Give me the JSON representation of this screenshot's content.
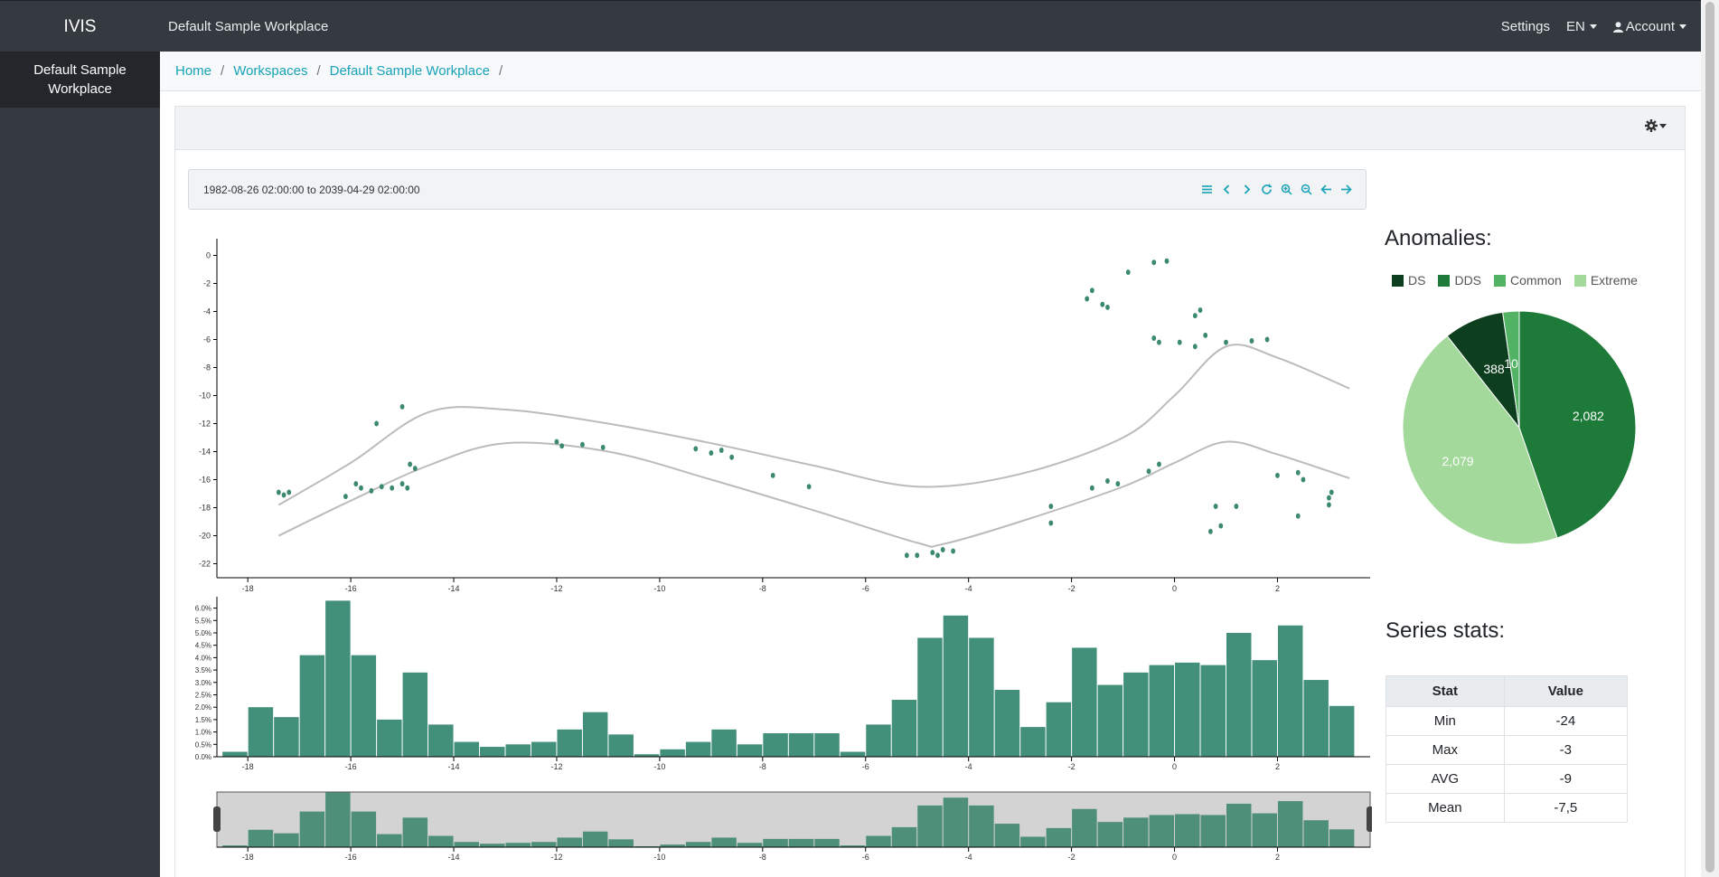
{
  "app": {
    "brand": "IVIS",
    "page_title": "Default Sample Workplace"
  },
  "nav": {
    "settings": "Settings",
    "language": "EN",
    "account": "Account"
  },
  "sidebar": {
    "items": [
      {
        "label": "Default Sample Workplace"
      }
    ]
  },
  "breadcrumb": [
    {
      "label": "Home"
    },
    {
      "label": "Workspaces"
    },
    {
      "label": "Default Sample Workplace"
    }
  ],
  "time_range": {
    "from": "1982-08-26 02:00:00",
    "to_word": "to",
    "to": "2039-04-29 02:00:00"
  },
  "toolbar_icons": [
    "menu-icon",
    "chevron-left-icon",
    "chevron-right-icon",
    "refresh-icon",
    "zoom-in-icon",
    "zoom-out-icon",
    "arrow-left-icon",
    "arrow-right-icon"
  ],
  "anomalies": {
    "title": "Anomalies:",
    "legend": [
      {
        "label": "DS",
        "color": "#0d3f1e"
      },
      {
        "label": "DDS",
        "color": "#1e7a38"
      },
      {
        "label": "Common",
        "color": "#52b365"
      },
      {
        "label": "Extreme",
        "color": "#a3d99b"
      }
    ]
  },
  "series_stats": {
    "title": "Series stats:",
    "headers": [
      "Stat",
      "Value"
    ],
    "rows": [
      {
        "stat": "Min",
        "value": "-24"
      },
      {
        "stat": "Max",
        "value": "-3"
      },
      {
        "stat": "AVG",
        "value": "-9"
      },
      {
        "stat": "Mean",
        "value": "-7,5"
      }
    ]
  },
  "colors": {
    "point": "#3c8a6e",
    "bar": "#43907a",
    "band": "#bbbbbb",
    "link": "#17a2b8"
  },
  "chart_data": [
    {
      "type": "scatter",
      "x_ticks": [
        -18,
        -16,
        -14,
        -12,
        -10,
        -8,
        -6,
        -4,
        -2,
        0,
        2
      ],
      "y_ticks": [
        0,
        -2,
        -4,
        -6,
        -8,
        -10,
        -12,
        -14,
        -16,
        -18,
        -20,
        -22
      ],
      "y_tick_labels": [
        "0",
        "-2",
        "-4",
        "-6",
        "-8",
        "-10",
        "-12",
        "-14",
        "-16",
        "-18",
        "-20",
        "-22"
      ],
      "xlim": [
        -18.6,
        3.8
      ],
      "ylim": [
        -23,
        1
      ],
      "points": [
        [
          -17.4,
          -16.9
        ],
        [
          -17.3,
          -17.1
        ],
        [
          -17.2,
          -16.9
        ],
        [
          -16.1,
          -17.2
        ],
        [
          -15.9,
          -16.3
        ],
        [
          -15.8,
          -16.6
        ],
        [
          -15.6,
          -16.8
        ],
        [
          -15.4,
          -16.5
        ],
        [
          -15.2,
          -16.6
        ],
        [
          -15.0,
          -16.3
        ],
        [
          -14.9,
          -16.6
        ],
        [
          -14.85,
          -14.9
        ],
        [
          -14.75,
          -15.2
        ],
        [
          -15.5,
          -12.0
        ],
        [
          -15.0,
          -10.8
        ],
        [
          -12.0,
          -13.3
        ],
        [
          -11.9,
          -13.6
        ],
        [
          -11.5,
          -13.5
        ],
        [
          -11.1,
          -13.7
        ],
        [
          -9.3,
          -13.8
        ],
        [
          -9.0,
          -14.1
        ],
        [
          -8.8,
          -13.9
        ],
        [
          -8.6,
          -14.4
        ],
        [
          -7.8,
          -15.7
        ],
        [
          -7.1,
          -16.5
        ],
        [
          -5.2,
          -21.4
        ],
        [
          -5.0,
          -21.4
        ],
        [
          -4.7,
          -21.2
        ],
        [
          -4.6,
          -21.4
        ],
        [
          -4.5,
          -21.0
        ],
        [
          -4.3,
          -21.1
        ],
        [
          -2.4,
          -17.9
        ],
        [
          -2.4,
          -19.1
        ],
        [
          -1.6,
          -16.6
        ],
        [
          -1.3,
          -16.1
        ],
        [
          -1.1,
          -16.3
        ],
        [
          -0.5,
          -15.4
        ],
        [
          -0.3,
          -14.9
        ],
        [
          -1.7,
          -3.1
        ],
        [
          -1.6,
          -2.5
        ],
        [
          -1.4,
          -3.5
        ],
        [
          -1.3,
          -3.7
        ],
        [
          -0.9,
          -1.2
        ],
        [
          -0.4,
          -0.5
        ],
        [
          -0.15,
          -0.4
        ],
        [
          -0.4,
          -5.9
        ],
        [
          -0.3,
          -6.2
        ],
        [
          0.1,
          -6.2
        ],
        [
          0.4,
          -4.3
        ],
        [
          0.5,
          -3.9
        ],
        [
          0.4,
          -6.5
        ],
        [
          0.6,
          -5.7
        ],
        [
          1.0,
          -6.2
        ],
        [
          1.5,
          -6.1
        ],
        [
          1.8,
          -6.0
        ],
        [
          0.7,
          -19.7
        ],
        [
          0.9,
          -19.3
        ],
        [
          0.8,
          -17.9
        ],
        [
          1.2,
          -17.9
        ],
        [
          2.0,
          -15.7
        ],
        [
          2.4,
          -15.5
        ],
        [
          2.5,
          -16.0
        ],
        [
          2.4,
          -18.6
        ],
        [
          3.0,
          -17.3
        ],
        [
          3.0,
          -17.8
        ],
        [
          3.05,
          -16.9
        ]
      ],
      "upper_band": [
        [
          -17.4,
          -17.8
        ],
        [
          -16,
          -14.8
        ],
        [
          -14.5,
          -11.2
        ],
        [
          -13,
          -11.0
        ],
        [
          -11,
          -12.0
        ],
        [
          -9,
          -13.4
        ],
        [
          -7,
          -15.0
        ],
        [
          -5,
          -16.5
        ],
        [
          -3,
          -15.6
        ],
        [
          -1,
          -13.0
        ],
        [
          0,
          -10.0
        ],
        [
          1,
          -6.5
        ],
        [
          2,
          -7.3
        ],
        [
          3.4,
          -9.5
        ]
      ],
      "lower_band": [
        [
          -17.4,
          -20.0
        ],
        [
          -16,
          -17.5
        ],
        [
          -14.5,
          -15.0
        ],
        [
          -13,
          -13.4
        ],
        [
          -11,
          -14.0
        ],
        [
          -9,
          -16.0
        ],
        [
          -7,
          -18.2
        ],
        [
          -5,
          -20.5
        ],
        [
          -4.5,
          -20.6
        ],
        [
          -3,
          -19.0
        ],
        [
          -1,
          -16.5
        ],
        [
          0,
          -14.8
        ],
        [
          1,
          -13.3
        ],
        [
          2,
          -14.2
        ],
        [
          3.4,
          -15.9
        ]
      ]
    },
    {
      "type": "bar",
      "x_start": -18.5,
      "bin_width": 0.5,
      "values": [
        0.2,
        2.0,
        1.6,
        4.1,
        6.3,
        4.1,
        1.5,
        3.4,
        1.3,
        0.6,
        0.4,
        0.5,
        0.6,
        1.1,
        1.8,
        0.9,
        0.1,
        0.3,
        0.6,
        1.1,
        0.5,
        0.95,
        0.95,
        0.95,
        0.2,
        1.3,
        2.3,
        4.8,
        5.7,
        4.8,
        2.7,
        1.2,
        2.2,
        4.4,
        2.9,
        3.4,
        3.7,
        3.8,
        3.7,
        5.0,
        3.9,
        5.3,
        3.1,
        2.05
      ],
      "y_ticks": [
        0,
        0.5,
        1,
        1.5,
        2,
        2.5,
        3,
        3.5,
        4,
        4.5,
        5,
        5.5,
        6
      ],
      "y_tick_labels": [
        "0.0%",
        "0.5%",
        "1.0%",
        "1.5%",
        "2.0%",
        "2.5%",
        "3.0%",
        "3.5%",
        "4.0%",
        "4.5%",
        "5.0%",
        "5.5%",
        "6.0%"
      ],
      "ylim": [
        0,
        6.35
      ],
      "x_ticks": [
        -18,
        -16,
        -14,
        -12,
        -10,
        -8,
        -6,
        -4,
        -2,
        0,
        2
      ]
    },
    {
      "type": "pie",
      "slices": [
        {
          "label": "DS",
          "value": 388
        },
        {
          "label": "Common",
          "value": 106
        },
        {
          "label": "DDS",
          "value": 2082
        },
        {
          "label": "Extreme",
          "value": 2079
        }
      ],
      "value_labels": [
        "388",
        "106",
        "2,082",
        "2,079"
      ]
    }
  ]
}
